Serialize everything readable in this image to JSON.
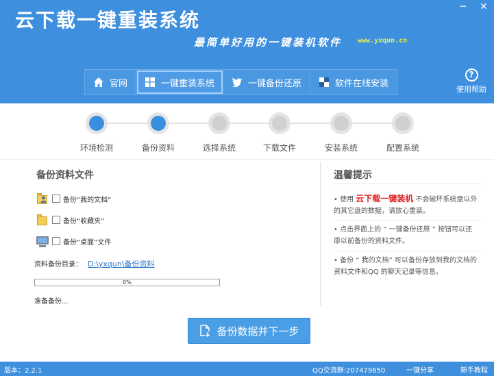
{
  "window": {
    "title": "云下载一键重装系统",
    "slogan": "最简单好用的一键装机软件",
    "url": "www.yxqun.cn",
    "controls": {
      "minimize": "─",
      "close": "✕"
    }
  },
  "nav": {
    "items": [
      {
        "label": "官网",
        "icon": "home-icon"
      },
      {
        "label": "一键重装系统",
        "icon": "windows-icon",
        "active": true
      },
      {
        "label": "一键备份还原",
        "icon": "bird-icon"
      },
      {
        "label": "软件在线安装",
        "icon": "grid-icon"
      }
    ]
  },
  "help": {
    "icon": "?",
    "label": "使用帮助"
  },
  "steps": [
    {
      "label": "环境检测",
      "done": true
    },
    {
      "label": "备份资料",
      "done": true
    },
    {
      "label": "选择系统",
      "done": false
    },
    {
      "label": "下载文件",
      "done": false
    },
    {
      "label": "安装系统",
      "done": false
    },
    {
      "label": "配置系统",
      "done": false
    }
  ],
  "backup": {
    "title": "备份资料文件",
    "options": [
      {
        "label": "备份“我的文档”",
        "icon": "documents-folder-icon",
        "checked": false
      },
      {
        "label": "备份“收藏夹”",
        "icon": "favorites-folder-icon",
        "checked": false
      },
      {
        "label": "备份“桌面”文件",
        "icon": "desktop-icon",
        "checked": false
      }
    ],
    "dir_label": "资料备份目录：",
    "dir_value": "D:\\yxqun\\备份资料",
    "progress_text": "0%",
    "progress_value": 0,
    "status": "准备备份..."
  },
  "tips": {
    "title": "温馨提示",
    "items": [
      {
        "prefix": "• 使用 ",
        "highlight": "云下载一键装机",
        "suffix": " 不会破坏系统盘以外的其它盘的数据，请放心重装。"
      },
      {
        "text": "• 点击界面上的 “ 一键备份还原 ” 按钮可以还原以前备份的资料文件。"
      },
      {
        "text": "• 备份 “ 我的文档” 可以备份存放到我的文档的资料文件和QQ 的聊天记录等信息。"
      }
    ]
  },
  "main_button": {
    "label": "备份数据并下一步",
    "icon": "backup-icon"
  },
  "footer": {
    "version": "版本：2.2.1",
    "qq": "QQ交流群:207479650",
    "share": "一键分享",
    "guide": "新手教程"
  },
  "colors": {
    "header": "#3e8fde",
    "step_done": "#3a8ee0",
    "step_pending": "#d0d0d0",
    "highlight": "#e02222",
    "url": "#e8f24a"
  }
}
